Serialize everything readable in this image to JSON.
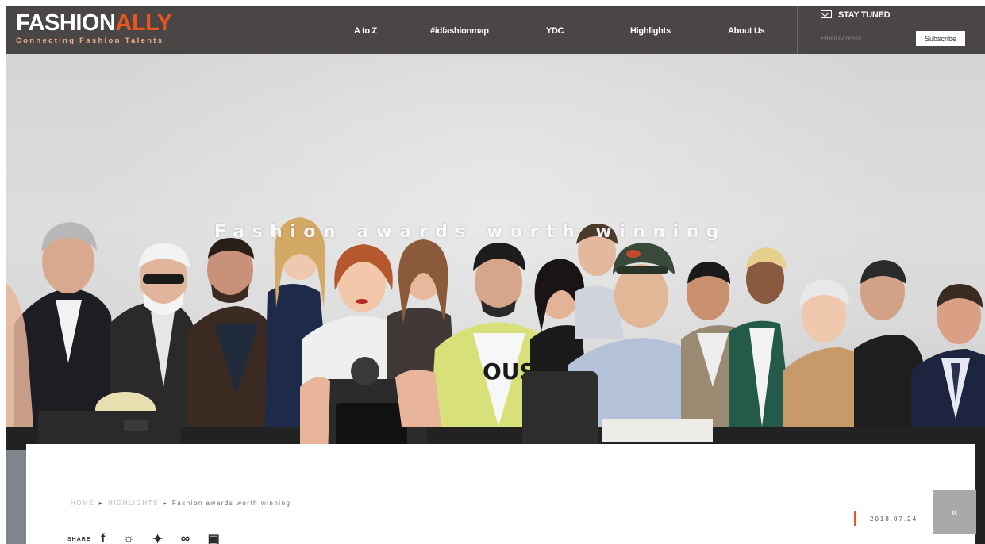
{
  "brand": {
    "logo_part1": "FASHION",
    "logo_part2": "ALLY",
    "tagline": "Connecting Fashion Talents",
    "accent_color": "#e8561e",
    "nav_bg": "#4a4646"
  },
  "nav": {
    "items": [
      {
        "label": "A to Z"
      },
      {
        "label": "#idfashionmap"
      },
      {
        "label": "YDC"
      },
      {
        "label": "Highlights"
      },
      {
        "label": "About Us"
      }
    ]
  },
  "newsletter": {
    "icon": "mail-icon",
    "title": "STAY TUNED",
    "email_placeholder": "Email Address",
    "subscribe_label": "Subscribe"
  },
  "hero": {
    "title": "Fashion awards worth winning"
  },
  "article": {
    "breadcrumb": {
      "home": "HOME",
      "section": "HIGHLIGHTS",
      "current": "Fashion awards worth winning"
    },
    "share_label": "SHARE",
    "share_icons": [
      "facebook-icon",
      "weibo-icon",
      "twitter-icon",
      "link-icon",
      "wechat-icon"
    ],
    "date": "2018.07.24"
  },
  "scroll_top": {
    "icon": "double-chevron-up-icon",
    "glyph": "«"
  }
}
